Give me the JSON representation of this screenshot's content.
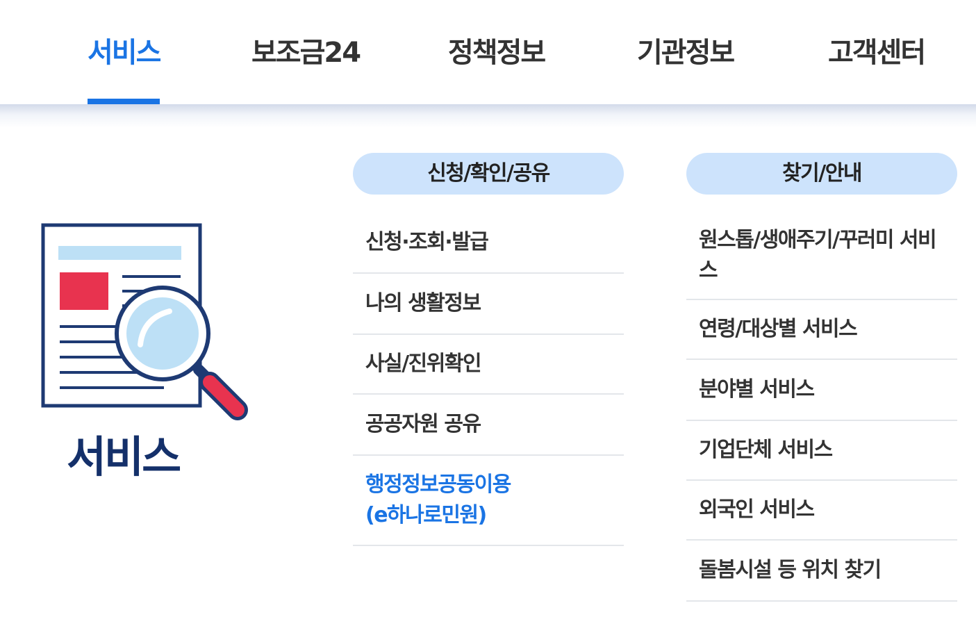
{
  "nav": {
    "tabs": [
      {
        "label": "서비스",
        "active": true
      },
      {
        "label": "보조금24",
        "active": false
      },
      {
        "label": "정책정보",
        "active": false
      },
      {
        "label": "기관정보",
        "active": false
      },
      {
        "label": "고객센터",
        "active": false
      }
    ]
  },
  "hero": {
    "title": "서비스",
    "icon": "document-magnifier-icon"
  },
  "columns": [
    {
      "header": "신청/확인/공유",
      "items": [
        {
          "label": "신청·조회·발급"
        },
        {
          "label": "나의 생활정보"
        },
        {
          "label": "사실/진위확인"
        },
        {
          "label": "공공자원 공유"
        },
        {
          "label": "행정정보공동이용\n(e하나로민원)",
          "highlighted": true
        }
      ]
    },
    {
      "header": "찾기/안내",
      "items": [
        {
          "label": "원스톱/생애주기/꾸러미 서비스"
        },
        {
          "label": "연령/대상별 서비스"
        },
        {
          "label": "분야별 서비스"
        },
        {
          "label": "기업단체 서비스"
        },
        {
          "label": "외국인 서비스"
        },
        {
          "label": "돌봄시설 등 위치 찾기"
        }
      ]
    }
  ],
  "colors": {
    "accent": "#1a74e4",
    "header_pill": "#cde3fc",
    "hero_title": "#14306a",
    "icon_red": "#e8334f",
    "icon_navy": "#1e3a73",
    "icon_lightblue": "#bde0f6"
  }
}
